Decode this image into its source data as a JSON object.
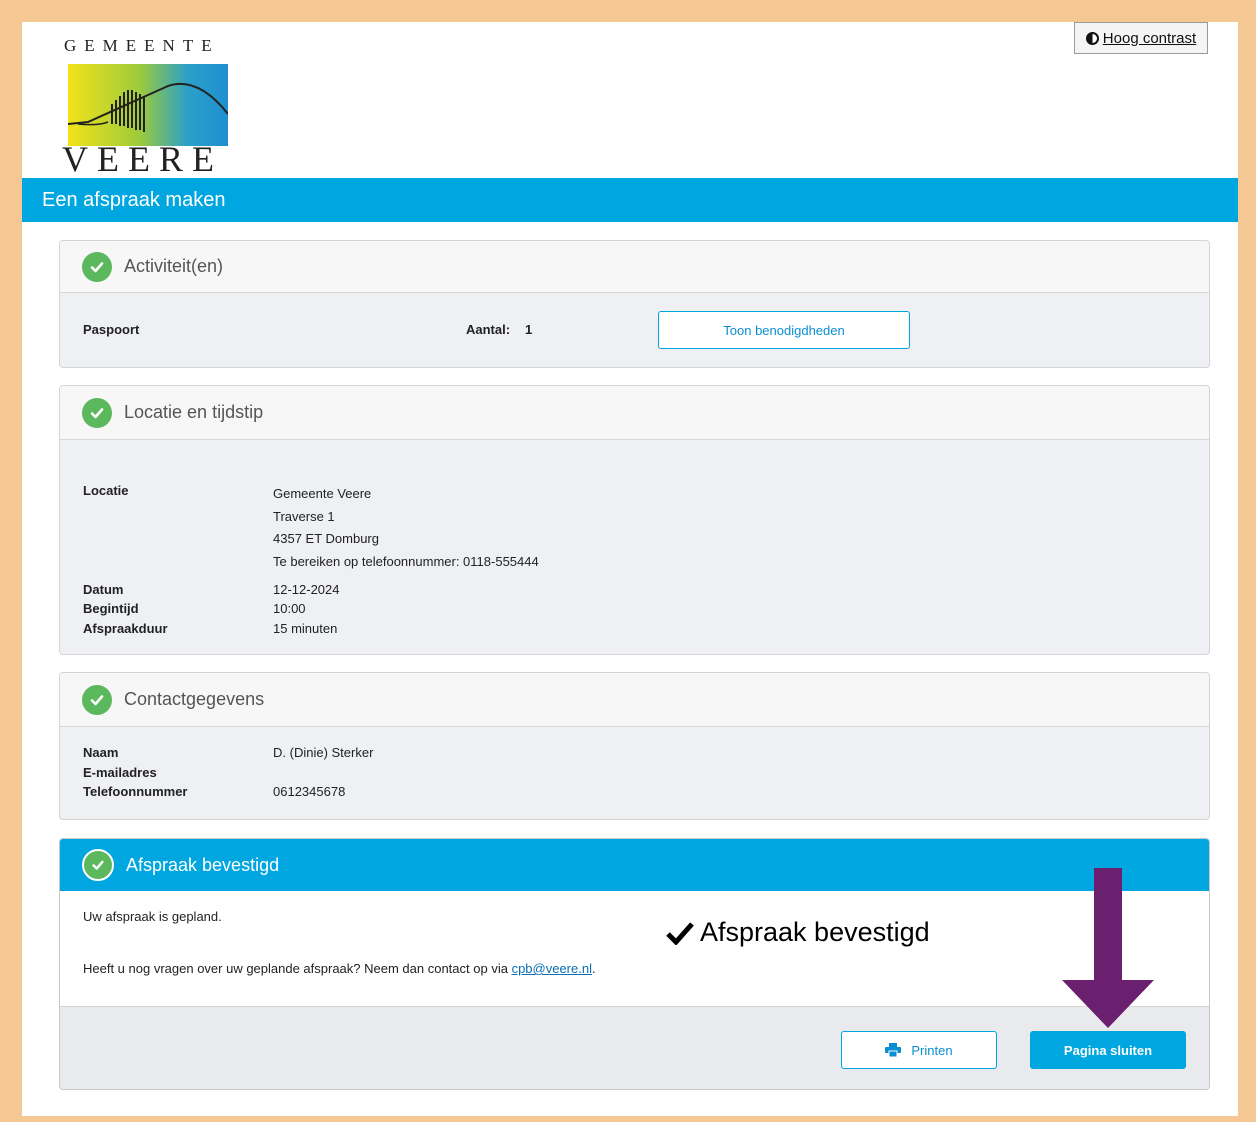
{
  "logo": {
    "top_text": "GEMEENTE",
    "bottom_text": "VEERE"
  },
  "header": {
    "contrast_label": "Hoog contrast"
  },
  "banner": {
    "title": "Een afspraak maken"
  },
  "activities": {
    "title": "Activiteit(en)",
    "product": "Paspoort",
    "count_label": "Aantal:",
    "count_value": "1",
    "button_label": "Toon benodigdheden"
  },
  "location": {
    "title": "Locatie en tijdstip",
    "location_label": "Locatie",
    "address_lines": [
      "Gemeente Veere",
      "Traverse 1",
      "4357 ET Domburg",
      "Te bereiken op telefoonnummer: 0118-555444"
    ],
    "date_label": "Datum",
    "date_value": "12-12-2024",
    "start_label": "Begintijd",
    "start_value": "10:00",
    "duration_label": "Afspraakduur",
    "duration_value": "15 minuten"
  },
  "contact": {
    "title": "Contactgegevens",
    "name_label": "Naam",
    "name_value": "D. (Dinie) Sterker",
    "email_label": "E-mailadres",
    "email_value": "",
    "phone_label": "Telefoonnummer",
    "phone_value": "0612345678"
  },
  "confirmation": {
    "title": "Afspraak bevestigd",
    "scheduled_text": "Uw afspraak is gepland.",
    "questions_text": "Heeft u nog vragen over uw geplande afspraak? Neem dan contact op via ",
    "email_link": "cpb@veere.nl",
    "period": ".",
    "annotation": "Afspraak bevestigd",
    "print_label": "Printen",
    "close_label": "Pagina sluiten"
  },
  "colors": {
    "frame": "#f5c893",
    "brand_blue": "#00a6df",
    "check_green": "#5cb85c",
    "arrow_purple": "#6a1f6f"
  }
}
